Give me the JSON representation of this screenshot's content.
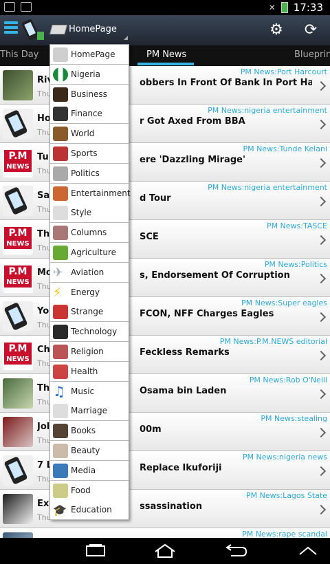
{
  "status_bar": {
    "time": "17:33"
  },
  "action_bar": {
    "spinner_label": "HomePage"
  },
  "tabs": [
    "This Day",
    "PM News",
    "Blueprint"
  ],
  "menu_items": [
    {
      "label": "HomePage",
      "icon": "book-icon"
    },
    {
      "label": "Nigeria",
      "icon": "nigeria-flag-icon"
    },
    {
      "label": "Business",
      "icon": "briefcase-icon"
    },
    {
      "label": "Finance",
      "icon": "cube-icon"
    },
    {
      "label": "World",
      "icon": "globe-icon"
    },
    {
      "label": "Sports",
      "icon": "stadium-icon"
    },
    {
      "label": "Politics",
      "icon": "capitol-icon"
    },
    {
      "label": "Entertainment",
      "icon": "film-icon"
    },
    {
      "label": "Style",
      "icon": "shoe-icon"
    },
    {
      "label": "Columns",
      "icon": "people-icon"
    },
    {
      "label": "Agriculture",
      "icon": "plant-icon"
    },
    {
      "label": "Aviation",
      "icon": "airplane-icon"
    },
    {
      "label": "Energy",
      "icon": "lightning-icon"
    },
    {
      "label": "Strange",
      "icon": "strange-icon"
    },
    {
      "label": "Technology",
      "icon": "chip-icon"
    },
    {
      "label": "Religion",
      "icon": "hands-icon"
    },
    {
      "label": "Health",
      "icon": "health-icon"
    },
    {
      "label": "Music",
      "icon": "music-note-icon"
    },
    {
      "label": "Marriage",
      "icon": "rings-icon"
    },
    {
      "label": "Books",
      "icon": "books-icon"
    },
    {
      "label": "Beauty",
      "icon": "beauty-icon"
    },
    {
      "label": "Media",
      "icon": "media-icon"
    },
    {
      "label": "Food",
      "icon": "food-icon"
    },
    {
      "label": "Education",
      "icon": "graduation-cap-icon"
    }
  ],
  "news": [
    {
      "title_left": "Riv",
      "title_right": "obbers In Front Of Bank In Port Harcourt",
      "date": "Thu",
      "source": "PM News:Port Harcourt",
      "thumb": "photo-a"
    },
    {
      "title_left": "Ho",
      "title_right": "r Got Axed From BBA",
      "date": "Thu",
      "source": "PM News:nigeria entertainment",
      "thumb": "phone"
    },
    {
      "title_left": "Tu",
      "title_right": "ere 'Dazzling Mirage'",
      "date": "Thu",
      "source": "PM News:Tunde Kelani",
      "thumb": "pm"
    },
    {
      "title_left": "Sa",
      "title_right": "d Tour",
      "date": "Thu",
      "source": "PM News:nigeria entertainment",
      "thumb": "phone"
    },
    {
      "title_left": "Th",
      "title_right": "SCE",
      "date": "Thu",
      "source": "PM News:TASCE",
      "thumb": "pm"
    },
    {
      "title_left": "Mo",
      "title_right": "s, Endorsement Of Corruption",
      "date": "Thu",
      "source": "PM News:Politics",
      "thumb": "pm"
    },
    {
      "title_left": "Yo",
      "title_right": "FCON, NFF Charges Eagles",
      "date": "Thu",
      "source": "PM News:Super eagles",
      "thumb": "phone"
    },
    {
      "title_left": "Chi",
      "title_right": "Feckless Remarks",
      "date": "Thu",
      "source": "PM News:P.M.NEWS editorial",
      "thumb": "pm"
    },
    {
      "title_left": "Th",
      "title_right": "Osama bin Laden",
      "date": "Thu",
      "source": "PM News:Rob O'Neill",
      "thumb": "photo-d"
    },
    {
      "title_left": "Jol",
      "title_right": "00m",
      "date": "Thu",
      "source": "PM News:stealing",
      "thumb": "photo-b"
    },
    {
      "title_left": "7 L",
      "title_right": "Replace Ikuforiji",
      "date": "Thu",
      "source": "PM News:nigeria news",
      "thumb": "phone"
    },
    {
      "title_left": "Ex-",
      "title_right": "ssassination",
      "date": "Thu",
      "source": "PM News:Lagos State",
      "thumb": "photo-c"
    },
    {
      "title_left": "",
      "title_right": "",
      "date": "",
      "source": "PM News:rape scandal",
      "thumb": "photo-e"
    }
  ],
  "pm_logo": {
    "top": "P.M",
    "bottom": "NEWS"
  }
}
